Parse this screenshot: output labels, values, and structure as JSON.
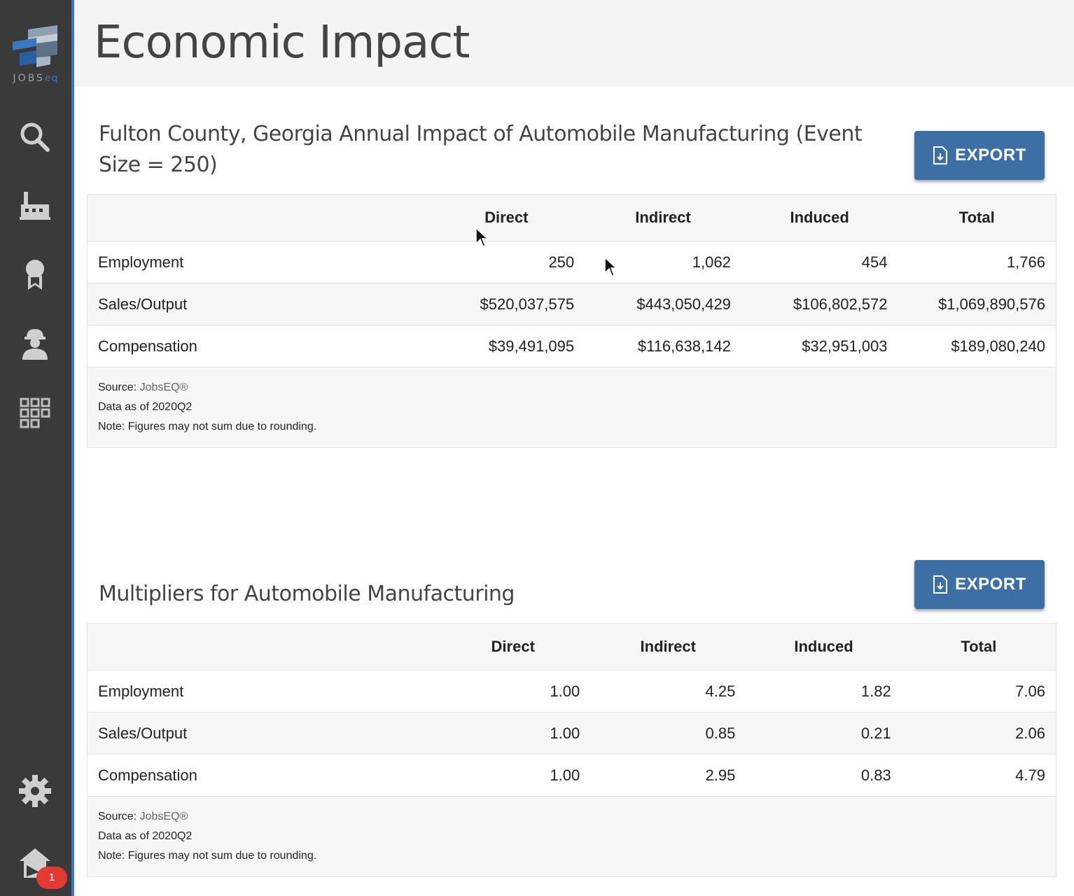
{
  "sidebar": {
    "logo_text": "JOBS",
    "logo_text_accent": "eq",
    "nav": [
      {
        "name": "search-icon"
      },
      {
        "name": "factory-icon"
      },
      {
        "name": "ribbon-award-icon"
      },
      {
        "name": "worker-icon"
      },
      {
        "name": "grid-icon"
      }
    ],
    "bottom": [
      {
        "name": "gear-icon"
      },
      {
        "name": "home-icon"
      }
    ],
    "notification_count": "1"
  },
  "header": {
    "title": "Economic Impact"
  },
  "impact": {
    "title": "Fulton County, Georgia Annual Impact of Automobile Manufacturing (Event Size = 250)",
    "export_label": "EXPORT",
    "columns": [
      "Direct",
      "Indirect",
      "Induced",
      "Total"
    ],
    "rows": [
      {
        "label": "Employment",
        "values": [
          "250",
          "1,062",
          "454",
          "1,766"
        ]
      },
      {
        "label": "Sales/Output",
        "values": [
          "$520,037,575",
          "$443,050,429",
          "$106,802,572",
          "$1,069,890,576"
        ]
      },
      {
        "label": "Compensation",
        "values": [
          "$39,491,095",
          "$116,638,142",
          "$32,951,003",
          "$189,080,240"
        ]
      }
    ],
    "source_label": "Source: ",
    "source_link": "JobsEQ®",
    "data_as_of": "Data as of 2020Q2",
    "note": "Note: Figures may not sum due to rounding."
  },
  "multipliers": {
    "title": "Multipliers for Automobile Manufacturing",
    "export_label": "EXPORT",
    "columns": [
      "Direct",
      "Indirect",
      "Induced",
      "Total"
    ],
    "rows": [
      {
        "label": "Employment",
        "values": [
          "1.00",
          "4.25",
          "1.82",
          "7.06"
        ]
      },
      {
        "label": "Sales/Output",
        "values": [
          "1.00",
          "0.85",
          "0.21",
          "2.06"
        ]
      },
      {
        "label": "Compensation",
        "values": [
          "1.00",
          "2.95",
          "0.83",
          "4.79"
        ]
      }
    ],
    "source_label": "Source: ",
    "source_link": "JobsEQ®",
    "data_as_of": "Data as of 2020Q2",
    "note": "Note: Figures may not sum due to rounding."
  },
  "colors": {
    "sidebar_bg": "#3a3a3a",
    "accent_blue": "#3b78c3",
    "button_bg": "#3d6fa5",
    "badge_red": "#e53935"
  }
}
